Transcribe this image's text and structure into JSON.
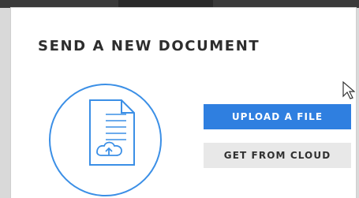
{
  "page": {
    "title": "SEND A NEW DOCUMENT"
  },
  "actions": {
    "upload_label": "UPLOAD A FILE",
    "cloud_label": "GET FROM CLOUD"
  },
  "icons": {
    "document": "document-icon",
    "cloud_upload": "cloud-upload-icon",
    "cursor": "mouse-pointer-icon"
  },
  "colors": {
    "accent": "#2f7fe0",
    "circle": "#3b8fe6",
    "secondary_button": "#e8e8e8",
    "title_text": "#2d2d2d"
  }
}
